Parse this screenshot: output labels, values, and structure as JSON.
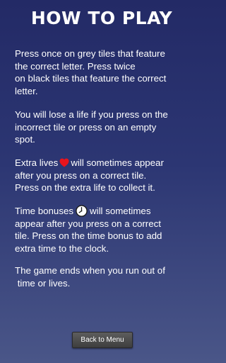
{
  "title": "HOW TO PLAY",
  "instructions": {
    "p1_line1": "Press once on grey tiles that feature",
    "p1_line2": "the correct letter.  Press twice",
    "p1_line3": "on black tiles that feature the correct",
    "p1_line4": "letter.",
    "p2_line1": "You will lose a life if you press on the",
    "p2_line2": "incorrect tile or press on an empty",
    "p2_line3": "spot.",
    "p3_line1_before": "Extra lives",
    "p3_line1_after": "will sometimes appear",
    "p3_line2": "after you press on a correct tile.",
    "p3_line3": "Press on the extra life to collect it.",
    "p4_line1_before": "Time bonuses",
    "p4_line1_after": "will sometimes",
    "p4_line2": "appear after you press on a correct",
    "p4_line3": "tile.  Press on the time bonus to add",
    "p4_line4": "extra time to the clock.",
    "p5_line1": "The game ends when you run out of",
    "p5_line2": " time or lives."
  },
  "icons": {
    "extra_life": "heart-icon",
    "time_bonus": "clock-icon"
  },
  "colors": {
    "heart": "#e8141c",
    "background_top": "#232a66",
    "background_bottom": "#4a5688",
    "button": "#4a4a4a"
  },
  "back_button_label": "Back to Menu"
}
